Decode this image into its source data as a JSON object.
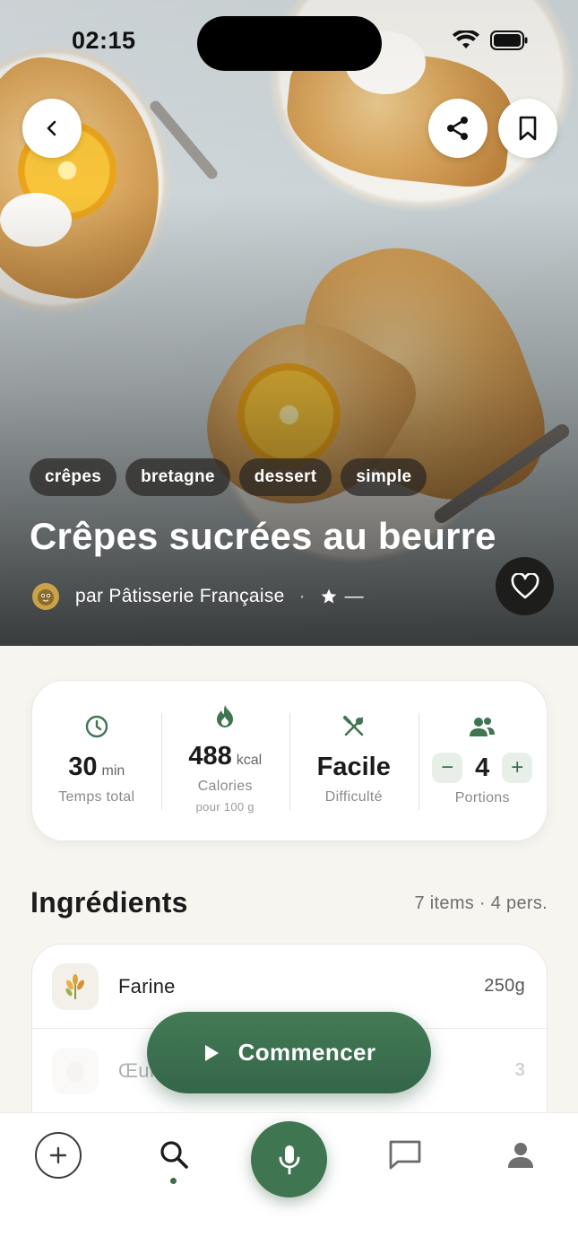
{
  "status_bar": {
    "time": "02:15"
  },
  "hero": {
    "tags": [
      "crêpes",
      "bretagne",
      "dessert",
      "simple"
    ],
    "title": "Crêpes sucrées au beurre",
    "author": "par Pâtisserie Française",
    "separator": "·",
    "rating": "—"
  },
  "stats": {
    "time": {
      "value": "30",
      "unit": "min",
      "label": "Temps total"
    },
    "calories": {
      "value": "488",
      "unit": "kcal",
      "label": "Calories",
      "sublabel": "pour 100 g"
    },
    "difficulty": {
      "value": "Facile",
      "label": "Difficulté"
    },
    "portions": {
      "value": "4",
      "label": "Portions",
      "minus": "−",
      "plus": "+"
    }
  },
  "ingredients": {
    "title": "Ingrédients",
    "meta": "7 items · 4 pers.",
    "items": [
      {
        "name": "Farine",
        "qty": "250g"
      },
      {
        "name": "Œufs",
        "qty": "3"
      }
    ]
  },
  "start_button": {
    "label": "Commencer"
  },
  "icons": {
    "back": "chevron-left-icon",
    "share": "share-icon",
    "bookmark": "bookmark-icon",
    "heart": "heart-icon",
    "clock": "clock-icon",
    "flame": "flame-icon",
    "utensils": "utensils-icon",
    "users": "users-icon",
    "plus": "plus-icon",
    "search": "search-icon",
    "mic": "mic-icon",
    "chat": "chat-icon",
    "profile": "profile-icon"
  },
  "colors": {
    "accent": "#3f7551",
    "accent_light": "#e8efe9",
    "text": "#1b1b1b",
    "muted": "#8a8a8a"
  }
}
